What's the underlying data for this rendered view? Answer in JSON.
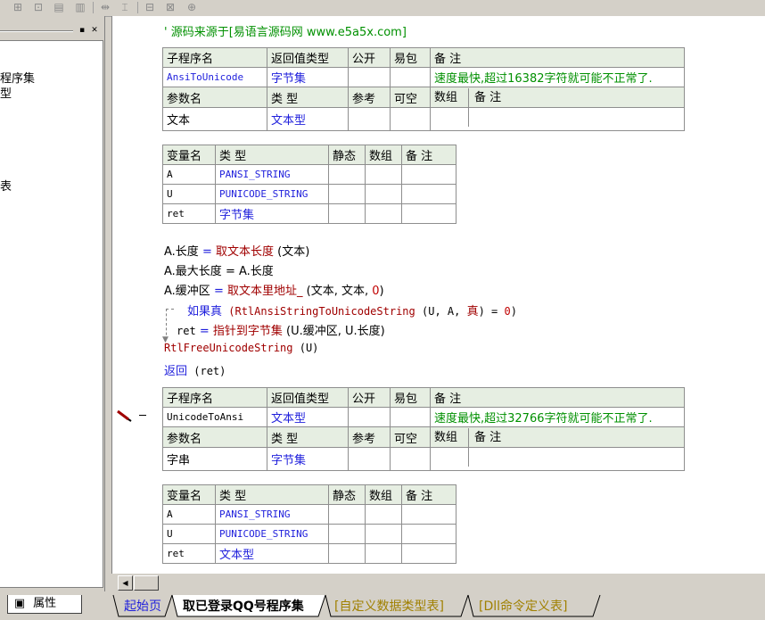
{
  "toolbar": {
    "icons": [
      "split-h-icon",
      "split-v-icon",
      "table-icon",
      "grid-icon",
      "indent-icon",
      "align-icon",
      "expand-h-icon",
      "expand-v-icon",
      "expand-all-icon"
    ]
  },
  "left_panel": {
    "tree_items": [
      "程序集",
      "型",
      "表"
    ],
    "properties_tab": "属性"
  },
  "code": {
    "source_comment": "' 源码来源于[易语言源码网 www.e5a5x.com]",
    "sub1": {
      "headers": [
        "子程序名",
        "返回值类型",
        "公开",
        "易包",
        "备 注"
      ],
      "name": "AnsiToUnicode",
      "return_type": "字节集",
      "comment": "速度最快,超过16382字符就可能不正常了.",
      "param_headers": [
        "参数名",
        "类 型",
        "参考",
        "可空",
        "数组",
        "备 注"
      ],
      "params": [
        {
          "name": "文本",
          "type": "文本型"
        }
      ],
      "var_headers": [
        "变量名",
        "类 型",
        "静态",
        "数组",
        "备 注"
      ],
      "vars": [
        {
          "name": "A",
          "type": "PANSI_STRING"
        },
        {
          "name": "U",
          "type": "PUNICODE_STRING"
        },
        {
          "name": "ret",
          "type": "字节集"
        }
      ]
    },
    "lines": {
      "l1_lhs": "A.长度",
      "l1_eq": " = ",
      "l1_fn": "取文本长度",
      "l1_args": " (文本)",
      "l2_lhs": "A.最大长度",
      "l2_rest": " = A.长度",
      "l3_lhs": "A.缓冲区",
      "l3_eq": " = ",
      "l3_fn": "取文本里地址_",
      "l3_args": " (文本, 文本, ",
      "l3_num": "0",
      "l3_close": ")",
      "l4_kw": "如果真",
      "l4_fn": " (RtlAnsiStringToUnicodeString",
      "l4_args": " (U, A, ",
      "l4_true": "真",
      "l4_close": ") = ",
      "l4_num": "0",
      "l4_end": ")",
      "l5_lhs": "ret",
      "l5_eq": " = ",
      "l5_fn": "指针到字节集",
      "l5_args": " (U.缓冲区, U.长度)",
      "l6_fn": "RtlFreeUnicodeString",
      "l6_args": " (U)",
      "l7_kw": "返回",
      "l7_args": " (ret)"
    },
    "sub2": {
      "headers": [
        "子程序名",
        "返回值类型",
        "公开",
        "易包",
        "备 注"
      ],
      "name": "UnicodeToAnsi",
      "return_type": "文本型",
      "comment": "速度最快,超过32766字符就可能不正常了.",
      "param_headers": [
        "参数名",
        "类 型",
        "参考",
        "可空",
        "数组",
        "备 注"
      ],
      "params": [
        {
          "name": "字串",
          "type": "字节集"
        }
      ],
      "var_headers": [
        "变量名",
        "类 型",
        "静态",
        "数组",
        "备 注"
      ],
      "vars": [
        {
          "name": "A",
          "type": "PANSI_STRING"
        },
        {
          "name": "U",
          "type": "PUNICODE_STRING"
        },
        {
          "name": "ret",
          "type": "文本型"
        }
      ]
    }
  },
  "tabs": [
    "起始页",
    "取已登录QQ号程序集",
    "[自定义数据类型表]",
    "[Dll命令定义表]"
  ],
  "colors": {
    "keyword_blue": "#1f1fdc",
    "comment_green": "#009000",
    "function_red": "#c00000",
    "header_bg": "#e6eee2"
  }
}
